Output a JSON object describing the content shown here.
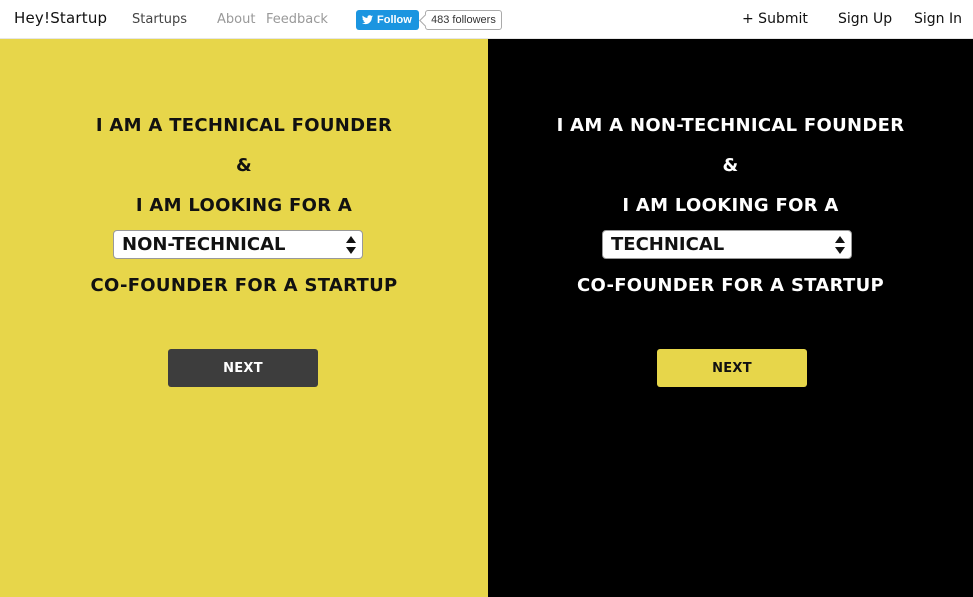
{
  "header": {
    "logo": "Hey!Startup",
    "nav": {
      "startups": "Startups",
      "about": "About",
      "feedback": "Feedback"
    },
    "twitter": {
      "follow_label": "Follow",
      "followers": "483 followers"
    },
    "right": {
      "submit": "+ Submit",
      "signup": "Sign Up",
      "signin": "Sign In"
    }
  },
  "left_panel": {
    "line1": "I AM A TECHNICAL FOUNDER",
    "line2": "&",
    "line3": "I AM LOOKING FOR A",
    "select_value": "NON-TECHNICAL",
    "line5": "CO-FOUNDER FOR A STARTUP",
    "next_label": "NEXT",
    "bg_color": "#e7d64a"
  },
  "right_panel": {
    "line1": "I AM A NON-TECHNICAL FOUNDER",
    "line2": "&",
    "line3": "I AM LOOKING FOR A",
    "select_value": "TECHNICAL",
    "line5": "CO-FOUNDER FOR A STARTUP",
    "next_label": "NEXT",
    "bg_color": "#000000"
  },
  "icons": {
    "twitter": "twitter-bird-icon",
    "select_arrows": "select-arrows-icon"
  }
}
